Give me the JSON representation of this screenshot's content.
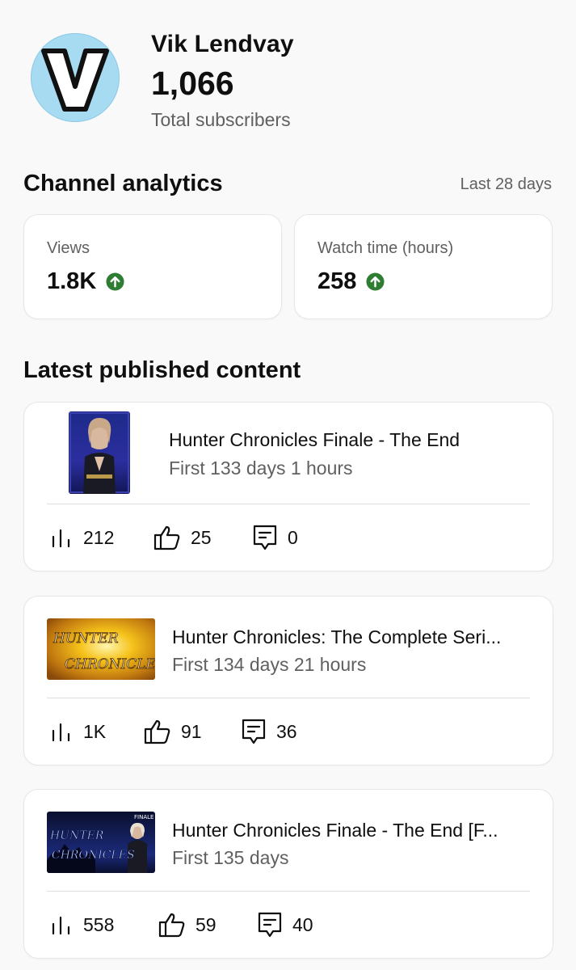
{
  "channel": {
    "name": "Vik Lendvay",
    "subscriber_count": "1,066",
    "subscriber_label": "Total subscribers",
    "avatar_letter": "V"
  },
  "analytics": {
    "title": "Channel analytics",
    "period": "Last 28 days",
    "metrics": [
      {
        "label": "Views",
        "value": "1.8K",
        "trend": "up"
      },
      {
        "label": "Watch time (hours)",
        "value": "258",
        "trend": "up"
      }
    ]
  },
  "latest": {
    "title": "Latest published content",
    "items": [
      {
        "title": "Hunter Chronicles Finale - The End",
        "subtitle": "First 133 days 1 hours",
        "views": "212",
        "likes": "25",
        "comments": "0"
      },
      {
        "title": "Hunter Chronicles: The Complete Seri...",
        "subtitle": "First 134 days 21 hours",
        "views": "1K",
        "likes": "91",
        "comments": "36",
        "thumb_text": [
          "HUNTER",
          "CHRONICLES"
        ]
      },
      {
        "title": "Hunter Chronicles Finale - The End [F...",
        "subtitle": "First 135 days",
        "views": "558",
        "likes": "59",
        "comments": "40",
        "thumb_text": [
          "HUNTER",
          "CHRONICLES",
          "FINALE"
        ]
      }
    ]
  },
  "colors": {
    "trend_up": "#2e7d32",
    "text_secondary": "#606060"
  }
}
